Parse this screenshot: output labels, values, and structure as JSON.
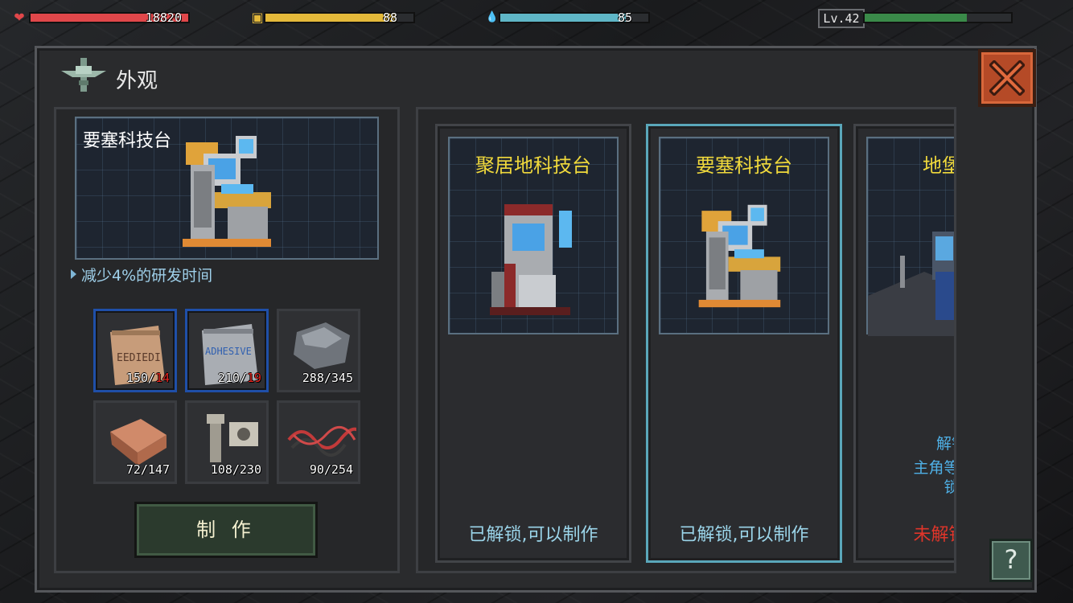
{
  "hud": {
    "health": {
      "value": "18820",
      "fill_pct": 100,
      "color": "#e0474a"
    },
    "food": {
      "value": "88",
      "fill_pct": 88,
      "color": "#e4b93a"
    },
    "water": {
      "value": "85",
      "fill_pct": 85,
      "color": "#5fb6c6"
    },
    "level": {
      "label": "Lv.42",
      "xp_fill_pct": 70,
      "color": "#3a8a49"
    }
  },
  "dialog": {
    "title": "外观",
    "selected": {
      "name": "要塞科技台",
      "bonus": "减少4%的研发时间"
    },
    "resources": [
      {
        "icon": "seed-bag-icon",
        "have": "150/",
        "need": "14",
        "need_color": "#e3241f"
      },
      {
        "icon": "adhesive-bag-icon",
        "have": "210/",
        "need": "19",
        "need_color": "#e3241f"
      },
      {
        "icon": "stone-icon",
        "have": "288/345",
        "need": ""
      },
      {
        "icon": "copper-ingot-icon",
        "have": "72/147",
        "need": ""
      },
      {
        "icon": "bolt-nut-icon",
        "have": "108/230",
        "need": ""
      },
      {
        "icon": "wire-icon",
        "have": "90/254",
        "need": ""
      }
    ],
    "craft_label": "制 作",
    "cards": [
      {
        "title": "聚居地科技台",
        "status": "已解锁,可以制作",
        "locked": false
      },
      {
        "title": "要塞科技台",
        "status": "已解锁,可以制作",
        "locked": false,
        "selected": true
      },
      {
        "title": "地堡科",
        "unlock_line1": "解锁",
        "unlock_line2": "主角等级达",
        "unlock_line3": "锁",
        "status": "未解锁,无",
        "locked": true
      }
    ],
    "help_label": "?"
  }
}
